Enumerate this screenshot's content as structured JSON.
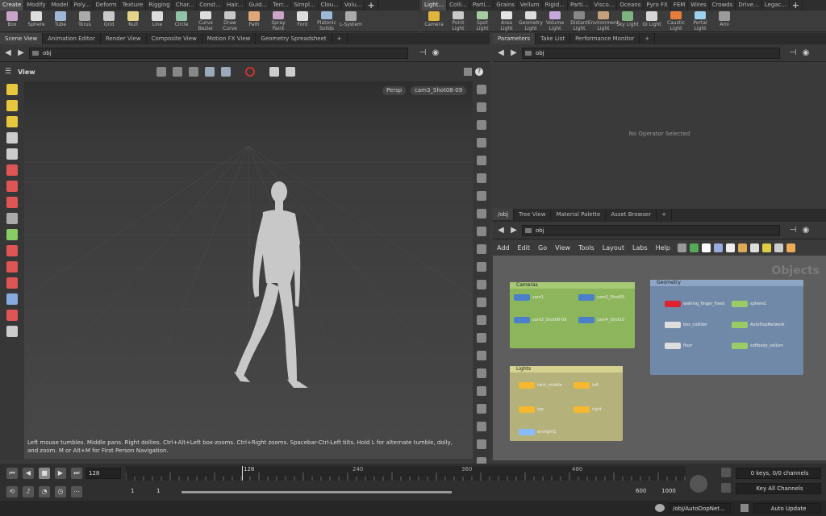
{
  "shelf_left": {
    "tabs": [
      "Create",
      "Modify",
      "Model",
      "Poly...",
      "Deform",
      "Texture",
      "Rigging",
      "Char...",
      "Const...",
      "Hair...",
      "Guid...",
      "Terr...",
      "Simpl...",
      "Clou...",
      "Volu..."
    ],
    "tools": [
      "Box",
      "Sphere",
      "Tube",
      "Torus",
      "Grid",
      "Null",
      "Line",
      "Circle",
      "Curve Bezier",
      "Draw Curve",
      "Path",
      "Spray Paint",
      "Font",
      "Platonic Solids",
      "L-System"
    ]
  },
  "shelf_right": {
    "tabs": [
      "Light...",
      "Colli...",
      "Parti...",
      "Grains",
      "Vellum",
      "Rigid...",
      "Parti...",
      "Visco...",
      "Oceans",
      "Pyro FX",
      "FEM",
      "Wires",
      "Crowds",
      "Drive...",
      "Legac..."
    ],
    "tools": [
      "Camera",
      "Point Light",
      "Spot Light",
      "Area Light",
      "Geometry Light",
      "Volume Light",
      "Distant Light",
      "Environment Light",
      "Sky Light",
      "GI Light",
      "Caustic Light",
      "Portal Light",
      "Ami"
    ]
  },
  "left_pane_tabs": [
    "Scene View",
    "Animation Editor",
    "Render View",
    "Composite View",
    "Motion FX View",
    "Geometry Spreadsheet"
  ],
  "right_pane_tabs": [
    "Parameters",
    "Take List",
    "Performance Monitor"
  ],
  "scene_path": "obj",
  "viewport": {
    "label": "View",
    "persp": "Persp",
    "camera": "cam3_Shot08-09",
    "hint": "Left mouse tumbles. Middle pans. Right dollies. Ctrl+Alt+Left box-zooms. Ctrl+Right zooms. Spacebar-Ctrl-Left tilts. Hold L for alternate tumble, dolly, and zoom.    M or Alt+M for First Person Navigation."
  },
  "params": {
    "path": "obj",
    "empty_text": "No Operator Selected"
  },
  "network": {
    "tabs": [
      "/obj",
      "Tree View",
      "Material Palette",
      "Asset Browser"
    ],
    "path": "obj",
    "menu": [
      "Add",
      "Edit",
      "Go",
      "View",
      "Tools",
      "Layout",
      "Labs",
      "Help"
    ],
    "context_label": "Objects",
    "cameras_title": "Cameras",
    "cameras": [
      "cam1",
      "cam2_Shot03",
      "cam3_Shot08-09",
      "cam4_Shot10"
    ],
    "geometry_title": "Geometry",
    "geometry": [
      "walking_finger_fixed",
      "sphere1",
      "box_collider",
      "AutoDopNetwork",
      "floor",
      "softbody_vellum"
    ],
    "lights_title": "Lights",
    "lights": [
      "tank_middle",
      "left",
      "top",
      "right",
      "envlight1"
    ]
  },
  "timeline": {
    "current_frame": "128",
    "ticks": [
      "128",
      "240",
      "360",
      "480"
    ],
    "start": "1",
    "range_start": "1",
    "range_end": "600",
    "end": "1000",
    "keys_info": "0 keys, 0/0 channels",
    "key_all": "Key All Channels"
  },
  "status": {
    "path": "/obj/AutoDopNet...",
    "update": "Auto Update"
  }
}
